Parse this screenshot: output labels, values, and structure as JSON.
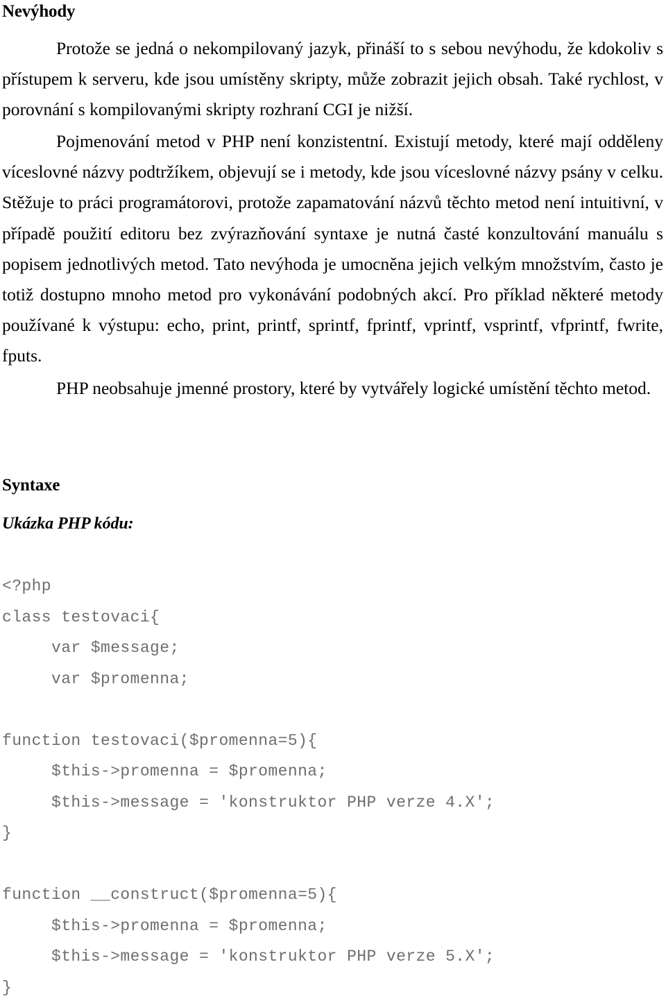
{
  "document": {
    "language": "cs",
    "background_color": "#ffffff",
    "text_color": "#000000",
    "code_color": "#6e6e6e"
  },
  "headings": {
    "nevyhody": "Nevýhody",
    "syntaxe": "Syntaxe",
    "ukazka": "Ukázka PHP kódu:"
  },
  "paragraphs": {
    "p1": "Protože se jedná o nekompilovaný jazyk, přináší to s sebou nevýhodu, že kdokoliv s přístupem k serveru, kde jsou umístěny skripty, může zobrazit jejich obsah. Také rychlost, v porovnání s kompilovanými skripty rozhraní CGI je nižší.",
    "p2": "Pojmenování metod v PHP není konzistentní. Existují metody, které mají odděleny víceslovné názvy podtržíkem, objevují se i metody, kde jsou víceslovné názvy psány v celku. Stěžuje to práci programátorovi, protože zapamatování názvů těchto metod není intuitivní, v případě použití editoru bez zvýrazňování syntaxe je nutná časté konzultování manuálu s popisem jednotlivých metod. Tato nevýhoda je umocněna jejich velkým množstvím, často je totiž dostupno mnoho metod pro vykonávání podobných akcí. Pro příklad některé metody používané k výstupu: echo, print, printf, sprintf, fprintf, vprintf, vsprintf, vfprintf, fwrite, fputs.",
    "p3": "PHP neobsahuje jmenné prostory, které by vytvářely logické umístění těchto metod."
  },
  "code_block": {
    "language": "php",
    "lines": [
      "<?php",
      "class testovaci{",
      "     var $message;",
      "     var $promenna;",
      "",
      "function testovaci($promenna=5){",
      "     $this->promenna = $promenna;",
      "     $this->message = 'konstruktor PHP verze 4.X';",
      "}",
      "",
      "function __construct($promenna=5){",
      "     $this->promenna = $promenna;",
      "     $this->message = 'konstruktor PHP verze 5.X';",
      "}"
    ]
  }
}
